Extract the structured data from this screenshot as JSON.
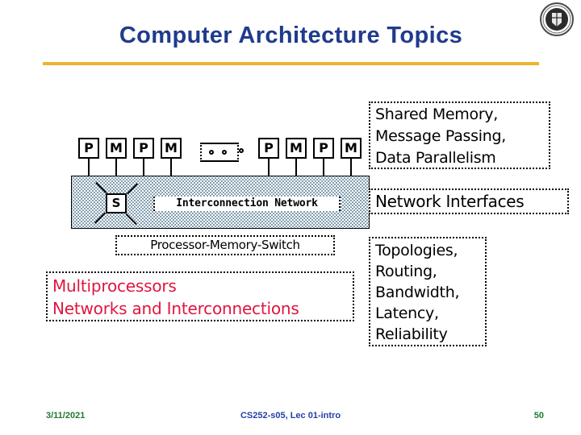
{
  "slide": {
    "title": "Computer Architecture Topics",
    "accent_color": "#edb32e",
    "title_color": "#1f3b8c",
    "logo_icon": "university-seal-icon"
  },
  "diagram": {
    "left_nodes": [
      {
        "label": "P"
      },
      {
        "label": "M"
      },
      {
        "label": "P"
      },
      {
        "label": "M"
      }
    ],
    "right_nodes": [
      {
        "label": "P"
      },
      {
        "label": "M"
      },
      {
        "label": "P"
      },
      {
        "label": "M"
      }
    ],
    "ellipsis_icon": "ellipsis-dots-icon",
    "switch_label": "S",
    "network_label": "Interconnection Network",
    "processor_memory_switch_label": "Processor-Memory-Switch"
  },
  "callouts": {
    "multiprocessors": {
      "line1": "Multiprocessors",
      "line2": "Networks and Interconnections",
      "color": "#e01540"
    },
    "shared_memory": {
      "line1": "Shared Memory,",
      "line2": "Message Passing,",
      "line3": "Data Parallelism"
    },
    "network_interfaces": {
      "line1": "Network Interfaces"
    },
    "topologies": {
      "line1": "Topologies,",
      "line2": "Routing,",
      "line3": "Bandwidth,",
      "line4": "Latency,",
      "line5": "Reliability"
    }
  },
  "footer": {
    "date": "3/11/2021",
    "center": "CS252-s05, Lec 01-intro",
    "page": "50",
    "date_color": "#1f7a32",
    "center_color": "#2440a8"
  }
}
